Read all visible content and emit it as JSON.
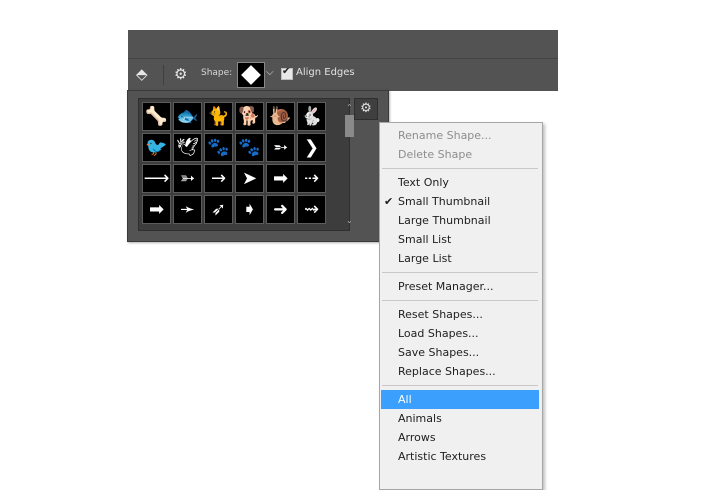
{
  "options_bar": {
    "shape_label": "Shape:",
    "align_edges_label": "Align Edges",
    "align_edges_checked": "✔"
  },
  "shape_picker": {
    "shapes": [
      {
        "name": "bone-icon",
        "glyph": "🦴"
      },
      {
        "name": "fish-icon",
        "glyph": "🐟"
      },
      {
        "name": "cat-icon",
        "glyph": "🐈"
      },
      {
        "name": "dog-icon",
        "glyph": "🐕"
      },
      {
        "name": "snail-icon",
        "glyph": "🐌"
      },
      {
        "name": "rabbit-icon",
        "glyph": "🐇"
      },
      {
        "name": "bird-icon",
        "glyph": "🐦"
      },
      {
        "name": "dove-icon",
        "glyph": "🕊"
      },
      {
        "name": "paw-print-icon",
        "glyph": "🐾"
      },
      {
        "name": "paw-print-2-icon",
        "glyph": "🐾"
      },
      {
        "name": "arrow-feather-icon",
        "glyph": "➵"
      },
      {
        "name": "chevron-right-icon",
        "glyph": "❯"
      },
      {
        "name": "thin-arrow-icon",
        "glyph": "⟶"
      },
      {
        "name": "fletched-arrow-icon",
        "glyph": "➳"
      },
      {
        "name": "line-arrow-icon",
        "glyph": "→"
      },
      {
        "name": "triangle-arrow-icon",
        "glyph": "➤"
      },
      {
        "name": "bold-arrow-icon",
        "glyph": "➡"
      },
      {
        "name": "dashed-arrow-icon",
        "glyph": "⇢"
      },
      {
        "name": "block-arrow-icon",
        "glyph": "➡"
      },
      {
        "name": "notched-arrow-icon",
        "glyph": "➛"
      },
      {
        "name": "feather-arrow-icon",
        "glyph": "➶"
      },
      {
        "name": "pentagon-arrow-icon",
        "glyph": "➧"
      },
      {
        "name": "thick-arrow-icon",
        "glyph": "➜"
      },
      {
        "name": "wave-arrow-icon",
        "glyph": "⇝"
      }
    ]
  },
  "menu": {
    "items": [
      {
        "label": "Rename Shape...",
        "state": "disabled"
      },
      {
        "label": "Delete Shape",
        "state": "disabled"
      },
      {
        "sep": true
      },
      {
        "label": "Text Only"
      },
      {
        "label": "Small Thumbnail",
        "check": "✔"
      },
      {
        "label": "Large Thumbnail"
      },
      {
        "label": "Small List"
      },
      {
        "label": "Large List"
      },
      {
        "sep": true
      },
      {
        "label": "Preset Manager..."
      },
      {
        "sep": true
      },
      {
        "label": "Reset Shapes..."
      },
      {
        "label": "Load Shapes..."
      },
      {
        "label": "Save Shapes..."
      },
      {
        "label": "Replace Shapes..."
      },
      {
        "sep": true
      },
      {
        "label": "All",
        "state": "active"
      },
      {
        "label": "Animals"
      },
      {
        "label": "Arrows"
      },
      {
        "label": "Artistic Textures"
      }
    ]
  }
}
